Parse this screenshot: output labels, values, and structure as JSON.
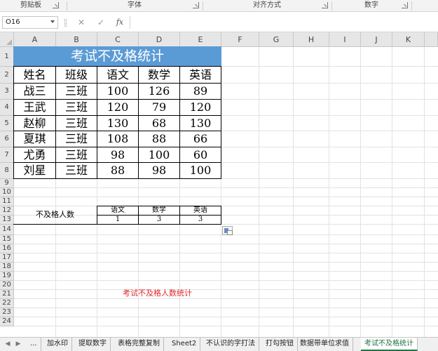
{
  "ribbon": {
    "groups": [
      "剪贴板",
      "字体",
      "对齐方式",
      "数字"
    ]
  },
  "formula_bar": {
    "name_box": "O16",
    "cancel_icon": "✕",
    "enter_icon": "✓",
    "fx_label": "fx",
    "content": ""
  },
  "columns": [
    "A",
    "B",
    "C",
    "D",
    "E",
    "F",
    "G",
    "H",
    "I",
    "J",
    "K"
  ],
  "rows": [
    "1",
    "2",
    "3",
    "4",
    "5",
    "6",
    "7",
    "8",
    "9",
    "10",
    "11",
    "12",
    "13",
    "14",
    "15",
    "16",
    "17",
    "18",
    "19",
    "20",
    "21",
    "22",
    "23",
    "24"
  ],
  "sheet": {
    "title": "考试不及格统计",
    "headers": [
      "姓名",
      "班级",
      "语文",
      "数学",
      "英语"
    ],
    "records": [
      [
        "战三",
        "三班",
        "100",
        "126",
        "89"
      ],
      [
        "王武",
        "三班",
        "120",
        "79",
        "120"
      ],
      [
        "赵柳",
        "三班",
        "130",
        "68",
        "130"
      ],
      [
        "夏琪",
        "三班",
        "108",
        "88",
        "66"
      ],
      [
        "尤勇",
        "三班",
        "98",
        "100",
        "60"
      ],
      [
        "刘星",
        "三班",
        "88",
        "98",
        "100"
      ]
    ],
    "fail_label": "不及格人数",
    "fail_subjects": [
      "语文",
      "数学",
      "英语"
    ],
    "fail_counts": [
      "1",
      "3",
      "3"
    ],
    "note": "考试不及格人数统计"
  },
  "tabs": {
    "nav_prev": "◀",
    "nav_next": "▶",
    "overflow": "...",
    "items": [
      "加水印",
      "提取数字",
      "表格完整复制",
      "Sheet2",
      "不认识的字打法",
      "打勾按钮",
      "数据带单位求值",
      "考试不及格统计"
    ],
    "active_index": 7
  },
  "colors": {
    "title_fill": "#5b9bd5",
    "title_text": "#ffffff",
    "note_text": "#e0282e",
    "active_tab": "#217346"
  }
}
